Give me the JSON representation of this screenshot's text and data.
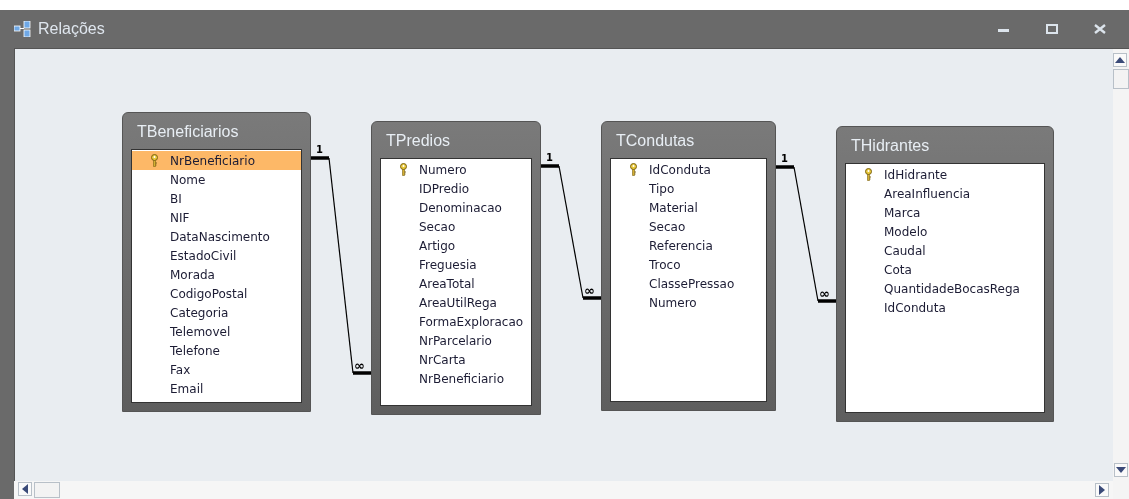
{
  "window": {
    "title": "Relações"
  },
  "tables": [
    {
      "name": "TBeneficiarios",
      "fields": [
        {
          "name": "NrBeneficiario",
          "key": true,
          "selected": true
        },
        {
          "name": "Nome",
          "key": false,
          "selected": false
        },
        {
          "name": "BI",
          "key": false,
          "selected": false
        },
        {
          "name": "NIF",
          "key": false,
          "selected": false
        },
        {
          "name": "DataNascimento",
          "key": false,
          "selected": false
        },
        {
          "name": "EstadoCivil",
          "key": false,
          "selected": false
        },
        {
          "name": "Morada",
          "key": false,
          "selected": false
        },
        {
          "name": "CodigoPostal",
          "key": false,
          "selected": false
        },
        {
          "name": "Categoria",
          "key": false,
          "selected": false
        },
        {
          "name": "Telemovel",
          "key": false,
          "selected": false
        },
        {
          "name": "Telefone",
          "key": false,
          "selected": false
        },
        {
          "name": "Fax",
          "key": false,
          "selected": false
        },
        {
          "name": "Email",
          "key": false,
          "selected": false
        }
      ]
    },
    {
      "name": "TPredios",
      "fields": [
        {
          "name": "Numero",
          "key": true,
          "selected": false
        },
        {
          "name": "IDPredio",
          "key": false,
          "selected": false
        },
        {
          "name": "Denominacao",
          "key": false,
          "selected": false
        },
        {
          "name": "Secao",
          "key": false,
          "selected": false
        },
        {
          "name": "Artigo",
          "key": false,
          "selected": false
        },
        {
          "name": "Freguesia",
          "key": false,
          "selected": false
        },
        {
          "name": "AreaTotal",
          "key": false,
          "selected": false
        },
        {
          "name": "AreaUtilRega",
          "key": false,
          "selected": false
        },
        {
          "name": "FormaExploracao",
          "key": false,
          "selected": false
        },
        {
          "name": "NrParcelario",
          "key": false,
          "selected": false
        },
        {
          "name": "NrCarta",
          "key": false,
          "selected": false
        },
        {
          "name": "NrBeneficiario",
          "key": false,
          "selected": false
        }
      ]
    },
    {
      "name": "TCondutas",
      "fields": [
        {
          "name": "IdConduta",
          "key": true,
          "selected": false
        },
        {
          "name": "Tipo",
          "key": false,
          "selected": false
        },
        {
          "name": "Material",
          "key": false,
          "selected": false
        },
        {
          "name": "Secao",
          "key": false,
          "selected": false
        },
        {
          "name": "Referencia",
          "key": false,
          "selected": false
        },
        {
          "name": "Troco",
          "key": false,
          "selected": false
        },
        {
          "name": "ClassePressao",
          "key": false,
          "selected": false
        },
        {
          "name": "Numero",
          "key": false,
          "selected": false
        }
      ]
    },
    {
      "name": "THidrantes",
      "fields": [
        {
          "name": "IdHidrante",
          "key": true,
          "selected": false
        },
        {
          "name": "AreaInfluencia",
          "key": false,
          "selected": false
        },
        {
          "name": "Marca",
          "key": false,
          "selected": false
        },
        {
          "name": "Modelo",
          "key": false,
          "selected": false
        },
        {
          "name": "Caudal",
          "key": false,
          "selected": false
        },
        {
          "name": "Cota",
          "key": false,
          "selected": false
        },
        {
          "name": "QuantidadeBocasRega",
          "key": false,
          "selected": false
        },
        {
          "name": "IdConduta",
          "key": false,
          "selected": false
        }
      ]
    }
  ],
  "relationships": [
    {
      "one_label": "1",
      "many_label": "∞"
    },
    {
      "one_label": "1",
      "many_label": "∞"
    },
    {
      "one_label": "1",
      "many_label": "∞"
    }
  ]
}
